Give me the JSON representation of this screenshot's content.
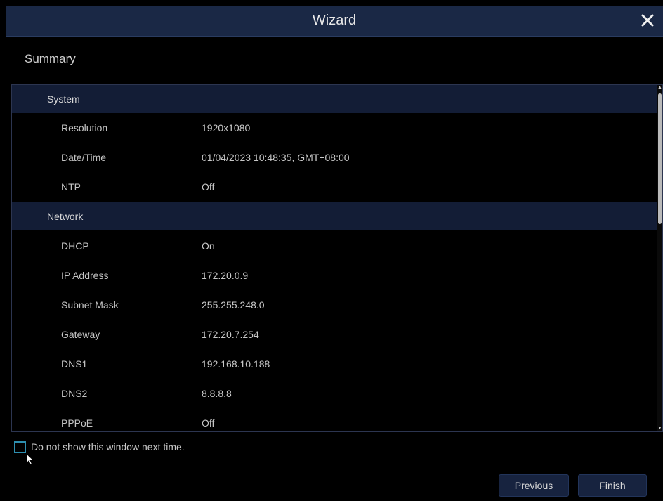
{
  "window": {
    "title": "Wizard"
  },
  "page": {
    "section_title": "Summary"
  },
  "summary": {
    "system": {
      "label": "System",
      "rows": [
        {
          "key": "Resolution",
          "value": "1920x1080"
        },
        {
          "key": "Date/Time",
          "value": "01/04/2023 10:48:35, GMT+08:00"
        },
        {
          "key": "NTP",
          "value": "Off"
        }
      ]
    },
    "network": {
      "label": "Network",
      "rows": [
        {
          "key": "DHCP",
          "value": "On"
        },
        {
          "key": "IP Address",
          "value": "172.20.0.9"
        },
        {
          "key": "Subnet Mask",
          "value": "255.255.248.0"
        },
        {
          "key": "Gateway",
          "value": "172.20.7.254"
        },
        {
          "key": "DNS1",
          "value": "192.168.10.188"
        },
        {
          "key": "DNS2",
          "value": "8.8.8.8"
        },
        {
          "key": "PPPoE",
          "value": "Off"
        }
      ]
    }
  },
  "options": {
    "dont_show_label": "Do not show this window next time."
  },
  "buttons": {
    "previous": "Previous",
    "finish": "Finish"
  },
  "colors": {
    "title_bar": "#1a2845",
    "group_row": "#131d36",
    "checkbox_border": "#2e8fb0",
    "button_bg": "#17233f"
  },
  "icons": {
    "close": "close-icon",
    "pointer": "mouse-pointer-icon"
  }
}
